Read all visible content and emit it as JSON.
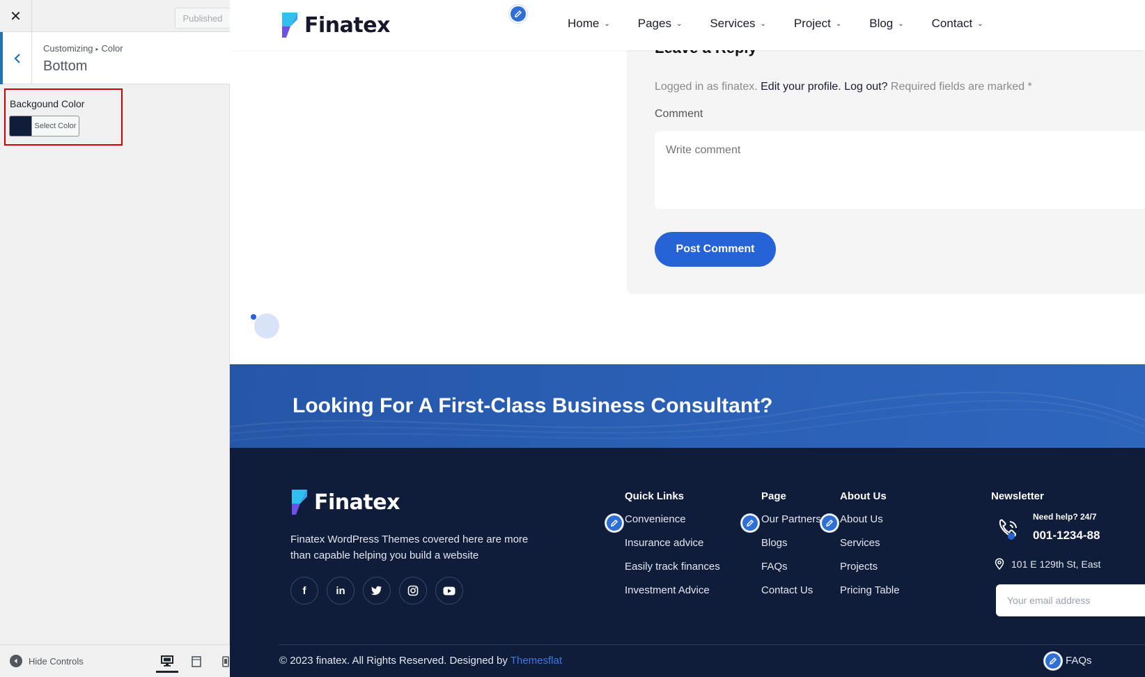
{
  "customizer": {
    "close_glyph": "✕",
    "publish_label": "Published",
    "back_glyph": "‹",
    "breadcrumb_root": "Customizing",
    "breadcrumb_separator": "▸",
    "breadcrumb_current": "Color",
    "section_title": "Bottom",
    "control_label": "Backgound Color",
    "select_color_label": "Select Color",
    "selected_color": "#0f1c3a",
    "hide_controls_label": "Hide Controls"
  },
  "site": {
    "brand": "Finatex",
    "nav": {
      "items": [
        {
          "label": "Home"
        },
        {
          "label": "Pages"
        },
        {
          "label": "Services"
        },
        {
          "label": "Project"
        },
        {
          "label": "Blog"
        },
        {
          "label": "Contact"
        }
      ]
    },
    "comments": {
      "heading": "Leave a Reply",
      "logged_in_as": "Logged in as finatex.",
      "edit_profile": "Edit your profile.",
      "log_out": "Log out?",
      "required_note": "Required fields are marked *",
      "comment_label": "Comment",
      "comment_placeholder": "Write comment",
      "post_button": "Post Comment"
    },
    "cta": {
      "title": "Looking For A First-Class Business Consultant?"
    },
    "footer": {
      "description": "Finatex WordPress Themes covered here are more than capable helping you build a website",
      "socials": [
        {
          "name": "facebook-icon",
          "glyph": "f"
        },
        {
          "name": "linkedin-icon",
          "glyph": "in"
        },
        {
          "name": "twitter-icon",
          "glyph": "🐦"
        },
        {
          "name": "instagram-icon",
          "glyph": "◎"
        },
        {
          "name": "youtube-icon",
          "glyph": "▶"
        }
      ],
      "quick_links": {
        "title": "Quick Links",
        "items": [
          "Convenience",
          "Insurance advice",
          "Easily track finances",
          "Investment Advice"
        ]
      },
      "page": {
        "title": "Page",
        "items": [
          "Our Partners",
          "Blogs",
          "FAQs",
          "Contact Us"
        ]
      },
      "about": {
        "title": "About Us",
        "items": [
          "About Us",
          "Services",
          "Projects",
          "Pricing Table"
        ]
      },
      "newsletter": {
        "title": "Newsletter",
        "help": "Need help? 24/7",
        "phone": "001-1234-88",
        "address": "101 E 129th St, East",
        "email_placeholder": "Your email address"
      },
      "copyright_text": "© 2023 finatex. All Rights Reserved. Designed by",
      "copyright_link": "Themesflat",
      "bottom_link": "FAQs"
    }
  },
  "colors": {
    "accent": "#2563d6",
    "footer_bg": "#0f1c3a",
    "cta_bg": "#2a5fb4",
    "highlight_border": "#d40000"
  }
}
